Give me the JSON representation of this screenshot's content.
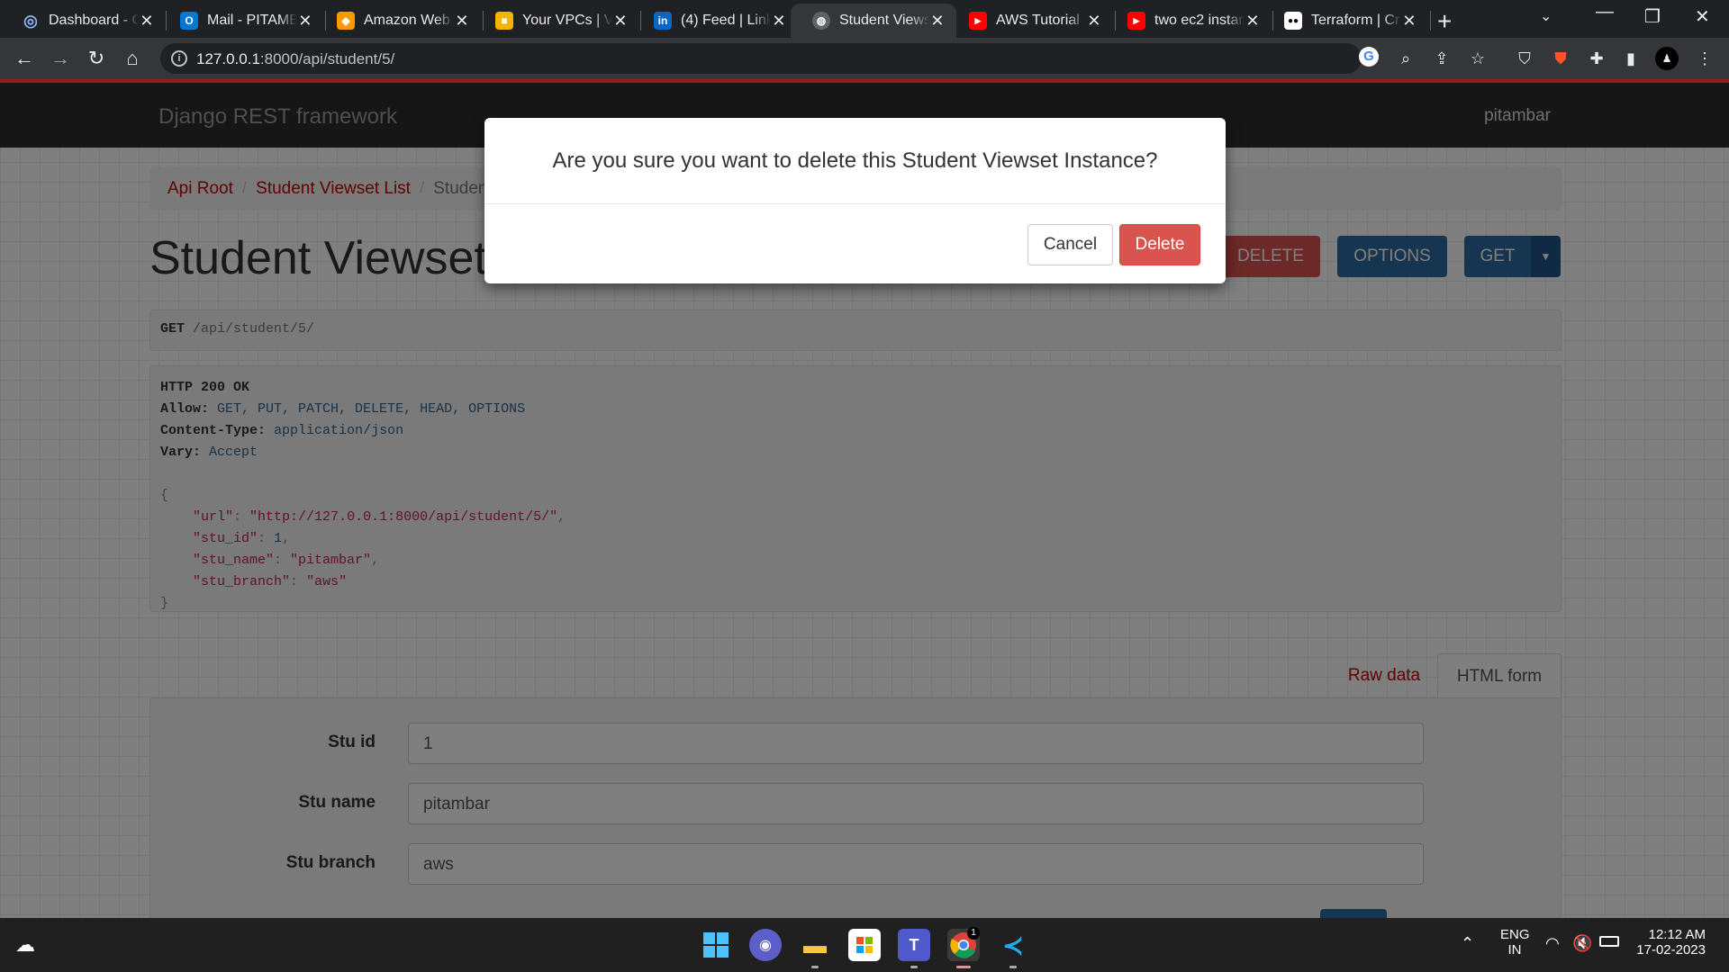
{
  "browser": {
    "tabs": [
      {
        "title": "Dashboard - C",
        "icon": "settings-globe-icon",
        "color": "#4285f4",
        "glyph": "◎"
      },
      {
        "title": "Mail - PITAMB",
        "icon": "outlook-icon",
        "color": "#0078d4",
        "glyph": "O"
      },
      {
        "title": "Amazon Web",
        "icon": "aws-cube-icon",
        "color": "#ff9900",
        "glyph": "◆"
      },
      {
        "title": "Your VPCs | VP",
        "icon": "aws-box-icon",
        "color": "#f4b400",
        "glyph": "■"
      },
      {
        "title": "(4) Feed | Link",
        "icon": "linkedin-icon",
        "color": "#0a66c2",
        "glyph": "in"
      },
      {
        "title": "Student Views",
        "icon": "globe-icon",
        "color": "#5f6368",
        "glyph": "◍"
      },
      {
        "title": "AWS Tutorial",
        "icon": "youtube-icon",
        "color": "#ff0000",
        "glyph": "▶"
      },
      {
        "title": "two ec2 instan",
        "icon": "youtube-icon",
        "color": "#ff0000",
        "glyph": "▶"
      },
      {
        "title": "Terraform | Cr",
        "icon": "medium-icon",
        "color": "#000000",
        "glyph": "●●"
      }
    ],
    "active_tab": 5,
    "url_host": "127.0.0.1",
    "url_rest": ":8000/api/student/5/"
  },
  "page": {
    "brand": "Django REST framework",
    "username": "pitambar",
    "breadcrumb": {
      "api_root": "Api Root",
      "list": "Student Viewset List",
      "current": "Student Viewset Instance"
    },
    "title": "Student Viewset Instance",
    "buttons": {
      "delete": "DELETE",
      "options": "OPTIONS",
      "get": "GET"
    },
    "request": {
      "method": "GET",
      "path": "/api/student/5/"
    },
    "response": {
      "status": "HTTP 200 OK",
      "allow_label": "Allow:",
      "allow_value": "GET, PUT, PATCH, DELETE, HEAD, OPTIONS",
      "content_type_label": "Content-Type:",
      "content_type_value": "application/json",
      "vary_label": "Vary:",
      "vary_value": "Accept",
      "json": {
        "url_key": "\"url\"",
        "url_val": "\"http://127.0.0.1:8000/api/student/5/\"",
        "stu_id_key": "\"stu_id\"",
        "stu_id_val": "1",
        "stu_name_key": "\"stu_name\"",
        "stu_name_val": "\"pitambar\"",
        "stu_branch_key": "\"stu_branch\"",
        "stu_branch_val": "\"aws\""
      }
    },
    "form_tabs": {
      "raw": "Raw data",
      "html": "HTML form"
    },
    "form": {
      "stu_id_label": "Stu id",
      "stu_id_value": "1",
      "stu_name_label": "Stu name",
      "stu_name_value": "pitambar",
      "stu_branch_label": "Stu branch",
      "stu_branch_value": "aws"
    }
  },
  "modal": {
    "message": "Are you sure you want to delete this Student Viewset Instance?",
    "cancel": "Cancel",
    "delete": "Delete"
  },
  "taskbar": {
    "lang": "ENG",
    "region": "IN",
    "time": "12:12 AM",
    "date": "17-02-2023",
    "chrome_badge": "1"
  },
  "colors": {
    "danger": "#d9534f",
    "primary": "#2c6aa0",
    "link": "#c20000",
    "navbar": "#2c2c2c"
  }
}
